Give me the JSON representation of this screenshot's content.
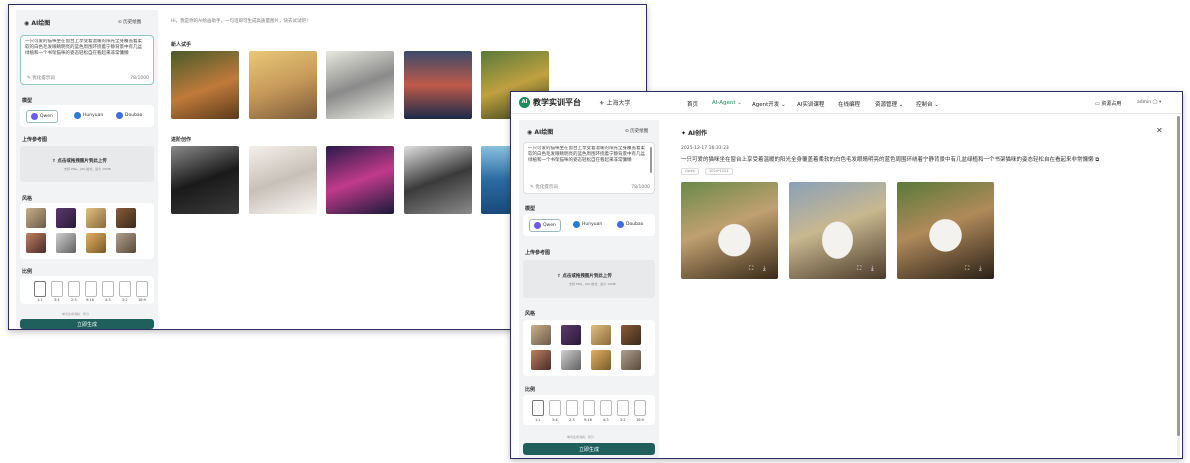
{
  "back": {
    "panel_title": "AI绘图",
    "history": "历史绘图",
    "prompt": "一只可爱的猫咪坐在窗台上享受着温暖的阳光全身覆盖着柔软的白色毛发眼睛明亮的蓝色周围环绕着宁静背景中有几盆绿植和一个书架猫咪的姿态轻松自在看起来非常慵懒",
    "char_count": "78/1000",
    "optimize": "优化提示词",
    "model_label": "模型",
    "models": [
      "Qwen",
      "Hunyuan",
      "Doubao"
    ],
    "ref_label": "上传参考图",
    "upload_text": "点击或拖拽图片到此上传",
    "upload_hint": "支持 PNG、JPG 格式，最大 10MB",
    "style_label": "风格",
    "ratio_label": "比例",
    "ratios": [
      "1:1",
      "3:4",
      "2:3",
      "9:16",
      "4:3",
      "3:2",
      "16:9"
    ],
    "cost": "单次生成消耗：积分",
    "generate": "立即生成",
    "welcome": "Hi，我是你的AI绘画助手，一句话即可生成高质量图片，快去试试吧！",
    "section_new": "新人试手",
    "section_adv": "进阶创作"
  },
  "front": {
    "brand": "教学实训平台",
    "school": "上海大学",
    "nav": [
      "首页",
      "AI-Agent",
      "Agent开发",
      "AI实训课程",
      "在线编程",
      "资源管理",
      "控制台"
    ],
    "resource": "资源占用",
    "user": "admin",
    "panel_title": "AI绘图",
    "history": "历史绘图",
    "prompt": "一只可爱的猫咪坐在窗台上享受着温暖的阳光全身覆盖着柔软的白色毛发眼睛明亮的蓝色周围环绕着宁静背景中有几盆绿植和一个书架猫咪的姿态轻松自在看起来非常慵懒",
    "char_count": "78/1000",
    "optimize": "优化提示词",
    "model_label": "模型",
    "models": [
      "Qwen",
      "Hunyuan",
      "Doubao"
    ],
    "ref_label": "上传参考图",
    "upload_text": "点击或拖拽图片到此上传",
    "upload_hint": "支持 PNG、JPG 格式，最大 10MB",
    "style_label": "风格",
    "ratio_label": "比例",
    "ratios": [
      "1:1",
      "3:4",
      "2:3",
      "9:16",
      "4:3",
      "3:2",
      "16:9"
    ],
    "cost": "单次生成消耗：积分",
    "generate": "立即生成",
    "result_title": "AI创作",
    "timestamp": "2025-12-17 16:33:23",
    "result_prompt": "一只可爱的猫咪坐在窗台上享受着温暖的阳光全身覆盖着柔软的白色毛发眼睛明亮的蓝色周围环绕着宁静背景中有几盆绿植和一个书架猫咪的姿态轻松自在看起来非常慵懒",
    "tag1": "Qwen",
    "tag2": "1024*1024"
  },
  "colors": {
    "accent": "#1f5f5c",
    "border": "#2b2f66"
  }
}
